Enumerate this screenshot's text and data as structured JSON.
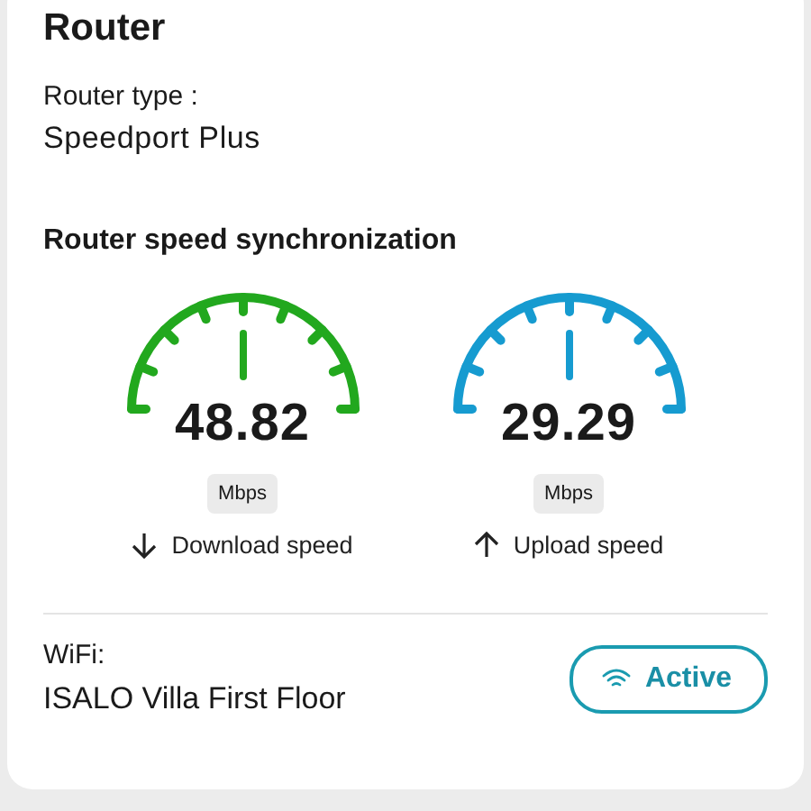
{
  "title": "Router",
  "router_type": {
    "label": "Router type :",
    "value": "Speedport Plus"
  },
  "sync": {
    "heading": "Router speed synchronization",
    "gauges": [
      {
        "kind": "download",
        "color": "#22a81e",
        "value": "48.82",
        "unit": "Mbps",
        "label": "Download speed"
      },
      {
        "kind": "upload",
        "color": "#169bd0",
        "value": "29.29",
        "unit": "Mbps",
        "label": "Upload speed"
      }
    ]
  },
  "wifi": {
    "label": "WiFi:",
    "name": "ISALO Villa First Floor",
    "status": "Active"
  }
}
